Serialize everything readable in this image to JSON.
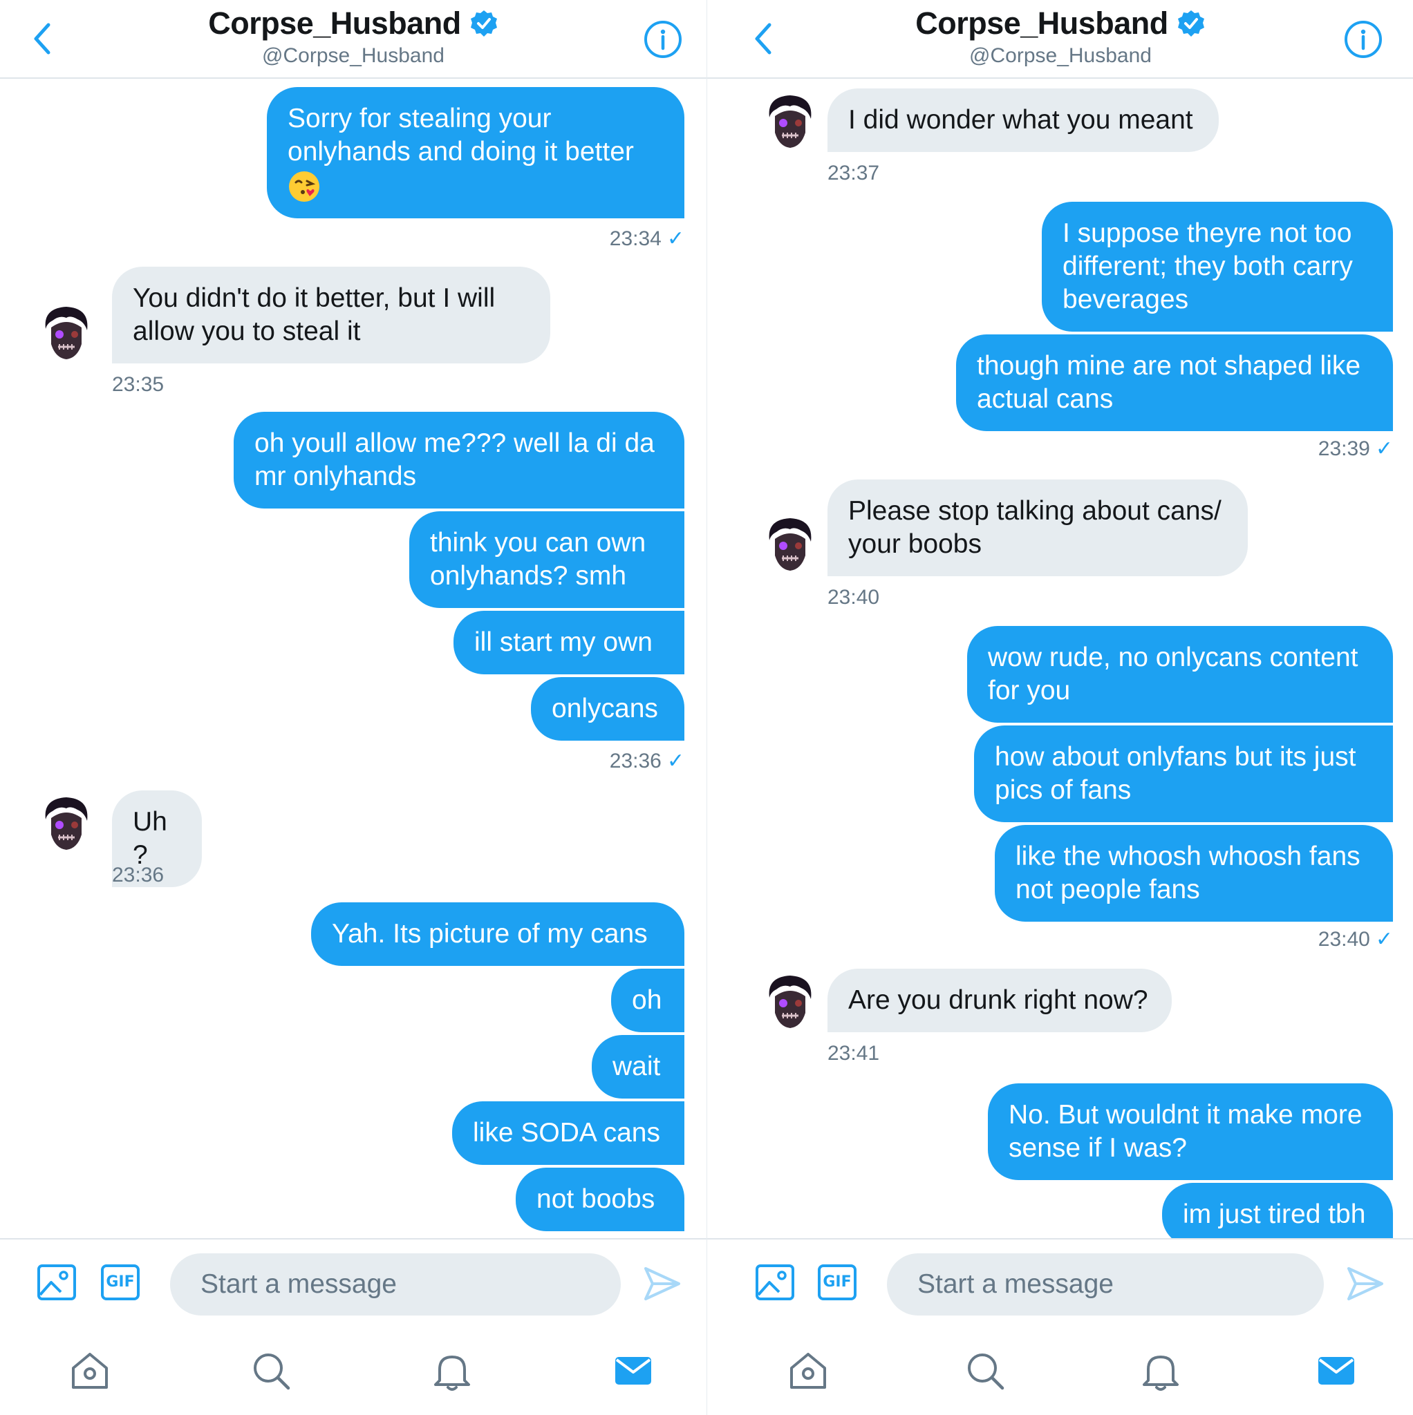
{
  "colors": {
    "brand": "#1da1f2",
    "incoming_bubble": "#e6ecf0",
    "text_primary": "#14171a",
    "text_secondary": "#657786"
  },
  "panels": [
    {
      "header": {
        "name": "Corpse_Husband",
        "handle": "@Corpse_Husband",
        "back_icon": "chevron-left-icon",
        "verified_icon": "verified-badge-icon",
        "info_icon": "info-icon"
      },
      "messages": [
        {
          "dir": "out",
          "text": "Sorry for stealing your onlyhands and doing it better",
          "emoji": "face-blowing-kiss"
        },
        {
          "dir": "meta-out",
          "time": "23:34",
          "read": true
        },
        {
          "dir": "in",
          "text": "You didn't do it better, but I will allow you to steal it"
        },
        {
          "dir": "meta-in",
          "time": "23:35"
        },
        {
          "dir": "out",
          "text": "oh youll allow me??? well la di da mr onlyhands"
        },
        {
          "dir": "out",
          "text": "think you can own onlyhands? smh"
        },
        {
          "dir": "out",
          "text": "ill start my own"
        },
        {
          "dir": "out",
          "text": "onlycans"
        },
        {
          "dir": "meta-out",
          "time": "23:36",
          "read": true
        },
        {
          "dir": "in",
          "text": "Uh?"
        },
        {
          "dir": "meta-in",
          "time": "23:36"
        },
        {
          "dir": "out",
          "text": "Yah. Its picture of my cans"
        },
        {
          "dir": "out",
          "text": "oh"
        },
        {
          "dir": "out",
          "text": "wait"
        },
        {
          "dir": "out",
          "text": "like SODA cans"
        },
        {
          "dir": "out",
          "text": "not boobs"
        }
      ],
      "composer": {
        "placeholder": "Start a message",
        "media_icon": "image-icon",
        "gif_label": "GIF",
        "send_icon": "send-icon"
      }
    },
    {
      "header": {
        "name": "Corpse_Husband",
        "handle": "@Corpse_Husband",
        "back_icon": "chevron-left-icon",
        "verified_icon": "verified-badge-icon",
        "info_icon": "info-icon"
      },
      "messages": [
        {
          "dir": "in",
          "text": "I did wonder what you meant"
        },
        {
          "dir": "meta-in",
          "time": "23:37"
        },
        {
          "dir": "out",
          "text": "I suppose theyre not too different; they both carry beverages"
        },
        {
          "dir": "out",
          "text": "though mine are not shaped like actual cans"
        },
        {
          "dir": "meta-out",
          "time": "23:39",
          "read": true
        },
        {
          "dir": "in",
          "text": "Please stop talking about cans/ your boobs"
        },
        {
          "dir": "meta-in",
          "time": "23:40"
        },
        {
          "dir": "out",
          "text": "wow rude, no onlycans content for you"
        },
        {
          "dir": "out",
          "text": "how about onlyfans but its just pics of fans"
        },
        {
          "dir": "out",
          "text": "like the whoosh whoosh fans not people fans"
        },
        {
          "dir": "meta-out",
          "time": "23:40",
          "read": true
        },
        {
          "dir": "in",
          "text": "Are you drunk right now?"
        },
        {
          "dir": "meta-in",
          "time": "23:41"
        },
        {
          "dir": "out",
          "text": "No. But wouldnt it make more sense if I was?"
        },
        {
          "dir": "out",
          "text": "im just tired tbh"
        }
      ],
      "composer": {
        "placeholder": "Start a message",
        "media_icon": "image-icon",
        "gif_label": "GIF",
        "send_icon": "send-icon"
      }
    }
  ],
  "tabbar": {
    "items": [
      "home-icon",
      "search-icon",
      "notifications-icon",
      "messages-icon"
    ],
    "active": "messages-icon"
  }
}
